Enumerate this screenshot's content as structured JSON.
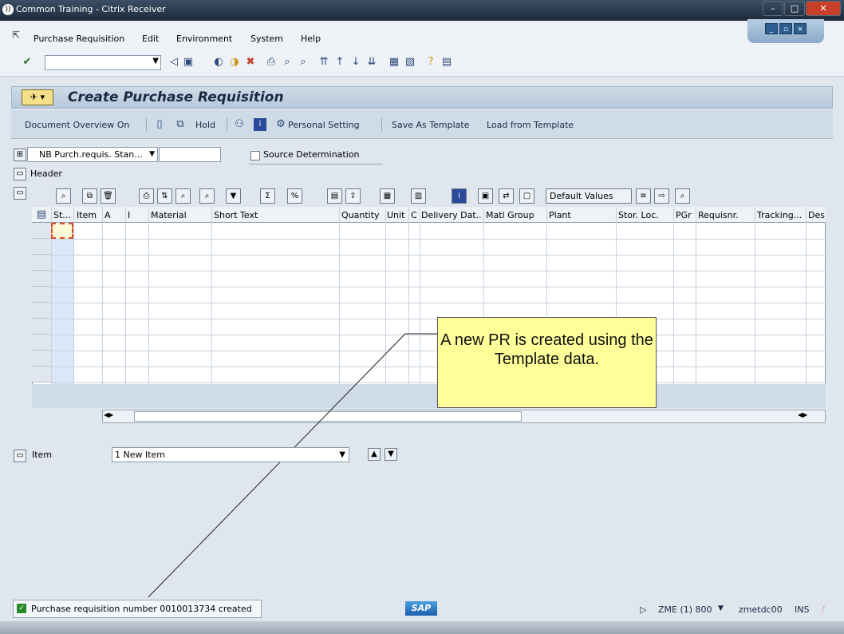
{
  "window": {
    "title": "Common Training - Citrix Receiver",
    "logo": "))"
  },
  "menu": {
    "items": [
      "Purchase Requisition",
      "Edit",
      "Environment",
      "System",
      "Help"
    ]
  },
  "screen": {
    "title": "Create Purchase Requisition",
    "icon_label": "✈ ▾"
  },
  "appbar": {
    "doc_overview": "Document Overview On",
    "hold": "Hold",
    "personal_setting": "Personal Setting",
    "save_template": "Save As Template",
    "load_template": "Load from Template"
  },
  "doc": {
    "type": "NB Purch.requis. Stan...",
    "source_determination": "Source Determination",
    "header": "Header"
  },
  "grid": {
    "default_values": "Default Values",
    "columns": [
      "St...",
      "Item",
      "A",
      "I",
      "Material",
      "Short Text",
      "Quantity",
      "Unit",
      "C",
      "Delivery Dat...",
      "Matl Group",
      "Plant",
      "Stor. Loc.",
      "PGr",
      "Requisnr.",
      "Tracking...",
      "Des"
    ]
  },
  "callout": {
    "text": "A new PR is created using the Template data."
  },
  "item": {
    "label": "Item",
    "selected": "1 New Item"
  },
  "status": {
    "message": "Purchase requisition number 0010013734 created",
    "system": "ZME (1) 800",
    "server": "zmetdc00",
    "mode": "INS",
    "sap_logo": "SAP"
  }
}
